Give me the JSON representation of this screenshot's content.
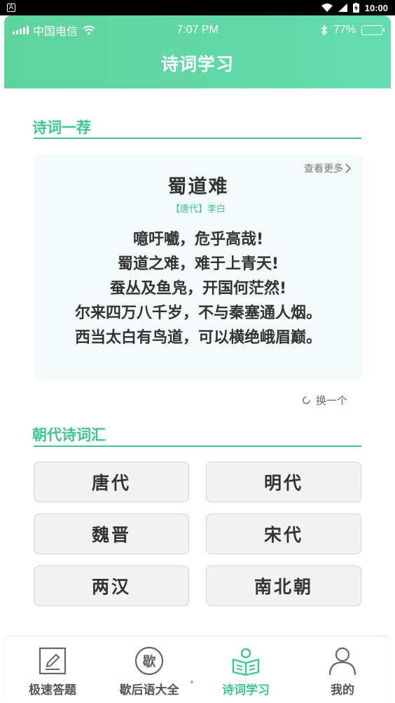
{
  "system_bar": {
    "time": "10:00"
  },
  "status_bar": {
    "carrier": "中国电信",
    "time": "7:07 PM",
    "battery": "77%",
    "battery_level": 0.77
  },
  "header": {
    "title": "诗词学习"
  },
  "recommend": {
    "section_title": "诗词一荐",
    "more_label": "查看更多",
    "poem": {
      "title": "蜀道难",
      "author": "【唐代】李白",
      "lines": [
        "噫吁嚱，危乎高哉!",
        "蜀道之难，难于上青天!",
        "蚕丛及鱼凫，开国何茫然!",
        "尔来四万八千岁，不与秦塞通人烟。",
        "西当太白有鸟道，可以横绝峨眉巅。"
      ]
    },
    "refresh_label": "换一个"
  },
  "dynasty": {
    "section_title": "朝代诗词汇",
    "items": [
      "唐代",
      "明代",
      "魏晋",
      "宋代",
      "两汉",
      "南北朝"
    ]
  },
  "tabs": [
    {
      "label": "极速答题",
      "icon": "edit-icon"
    },
    {
      "label": "歇后语大全",
      "icon": "xie-character-icon",
      "icon_text": "歇"
    },
    {
      "label": "诗词学习",
      "icon": "reading-icon",
      "active": true
    },
    {
      "label": "我的",
      "icon": "user-icon"
    }
  ],
  "colors": {
    "accent": "#3fc58d",
    "header_start": "#5fd39b",
    "header_end": "#62dcb0",
    "card_bg": "#f3fbfb"
  }
}
